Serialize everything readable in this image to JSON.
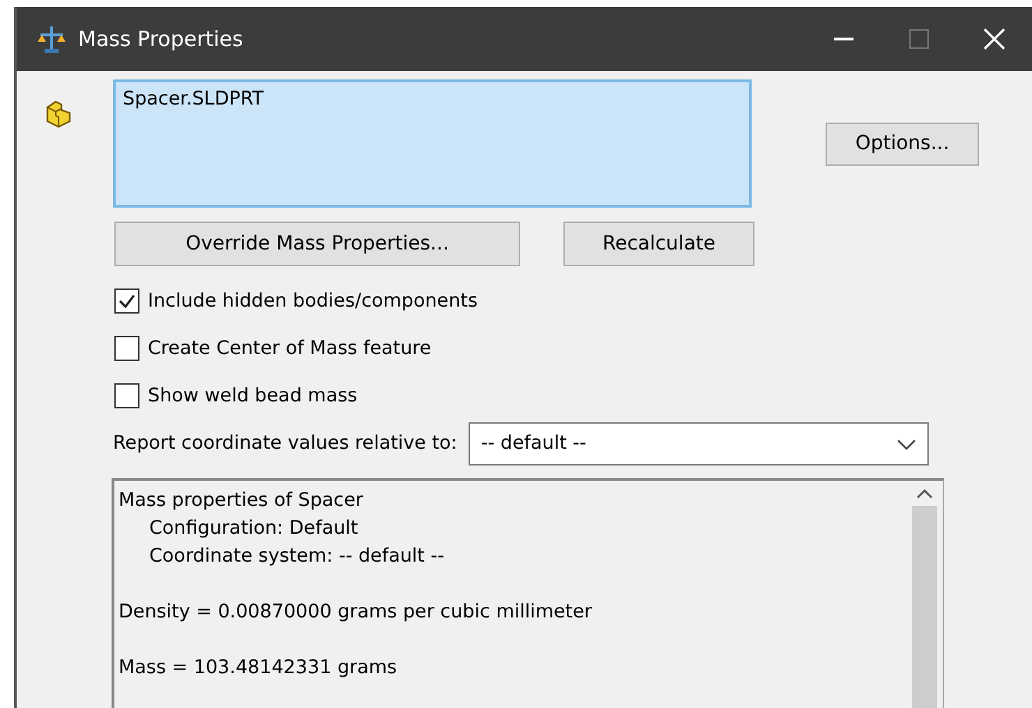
{
  "window": {
    "title": "Mass Properties"
  },
  "selection_list": {
    "items": [
      {
        "label": "Spacer.SLDPRT",
        "selected": false
      }
    ]
  },
  "buttons": {
    "options": "Options...",
    "override": "Override Mass Properties...",
    "recalculate": "Recalculate"
  },
  "checkboxes": [
    {
      "label": "Include hidden bodies/components",
      "checked": true
    },
    {
      "label": "Create Center of Mass feature",
      "checked": false
    },
    {
      "label": "Show weld bead mass",
      "checked": false
    }
  ],
  "coordinate_system": {
    "label": "Report coordinate values relative to:",
    "value": "-- default --"
  },
  "results": {
    "lines": [
      {
        "text": "Mass properties of Spacer",
        "children": [
          {
            "text": "Configuration: Default"
          },
          {
            "text": "Coordinate system: -- default --"
          }
        ]
      },
      {
        "text": "Density = 0.00870000 grams per cubic millimeter"
      },
      {
        "text": "Mass = 103.48142331 grams"
      }
    ]
  }
}
